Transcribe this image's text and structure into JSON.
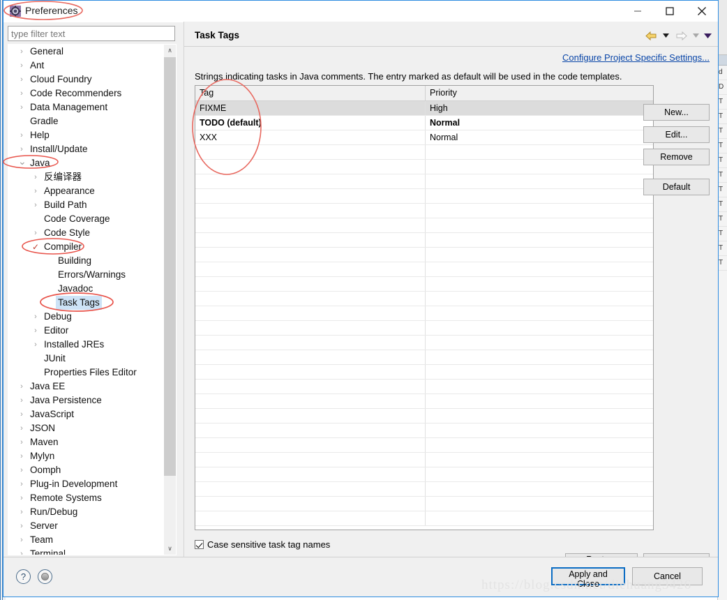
{
  "window": {
    "title": "Preferences",
    "icon": "preferences-gear-icon",
    "minimize_label": "Minimize",
    "maximize_label": "Maximize",
    "close_label": "Close"
  },
  "filter": {
    "placeholder": "type filter text",
    "value": ""
  },
  "tree": {
    "items": [
      {
        "label": "General",
        "indent": 0,
        "arrow": "collapsed",
        "check": false,
        "selected": false
      },
      {
        "label": "Ant",
        "indent": 0,
        "arrow": "collapsed",
        "check": false,
        "selected": false
      },
      {
        "label": "Cloud Foundry",
        "indent": 0,
        "arrow": "collapsed",
        "check": false,
        "selected": false
      },
      {
        "label": "Code Recommenders",
        "indent": 0,
        "arrow": "collapsed",
        "check": false,
        "selected": false
      },
      {
        "label": "Data Management",
        "indent": 0,
        "arrow": "collapsed",
        "check": false,
        "selected": false
      },
      {
        "label": "Gradle",
        "indent": 0,
        "arrow": "none",
        "check": false,
        "selected": false
      },
      {
        "label": "Help",
        "indent": 0,
        "arrow": "collapsed",
        "check": false,
        "selected": false
      },
      {
        "label": "Install/Update",
        "indent": 0,
        "arrow": "collapsed",
        "check": false,
        "selected": false
      },
      {
        "label": "Java",
        "indent": 0,
        "arrow": "expanded",
        "check": false,
        "selected": false
      },
      {
        "label": "反编译器",
        "indent": 1,
        "arrow": "collapsed",
        "check": false,
        "selected": false
      },
      {
        "label": "Appearance",
        "indent": 1,
        "arrow": "collapsed",
        "check": false,
        "selected": false
      },
      {
        "label": "Build Path",
        "indent": 1,
        "arrow": "collapsed",
        "check": false,
        "selected": false
      },
      {
        "label": "Code Coverage",
        "indent": 1,
        "arrow": "none",
        "check": false,
        "selected": false
      },
      {
        "label": "Code Style",
        "indent": 1,
        "arrow": "collapsed",
        "check": false,
        "selected": false
      },
      {
        "label": "Compiler",
        "indent": 1,
        "arrow": "check",
        "check": true,
        "selected": false
      },
      {
        "label": "Building",
        "indent": 2,
        "arrow": "none",
        "check": false,
        "selected": false
      },
      {
        "label": "Errors/Warnings",
        "indent": 2,
        "arrow": "none",
        "check": false,
        "selected": false
      },
      {
        "label": "Javadoc",
        "indent": 2,
        "arrow": "none",
        "check": false,
        "selected": false
      },
      {
        "label": "Task Tags",
        "indent": 2,
        "arrow": "none",
        "check": false,
        "selected": true
      },
      {
        "label": "Debug",
        "indent": 1,
        "arrow": "collapsed",
        "check": false,
        "selected": false
      },
      {
        "label": "Editor",
        "indent": 1,
        "arrow": "collapsed",
        "check": false,
        "selected": false
      },
      {
        "label": "Installed JREs",
        "indent": 1,
        "arrow": "collapsed",
        "check": false,
        "selected": false
      },
      {
        "label": "JUnit",
        "indent": 1,
        "arrow": "none",
        "check": false,
        "selected": false
      },
      {
        "label": "Properties Files Editor",
        "indent": 1,
        "arrow": "none",
        "check": false,
        "selected": false
      },
      {
        "label": "Java EE",
        "indent": 0,
        "arrow": "collapsed",
        "check": false,
        "selected": false
      },
      {
        "label": "Java Persistence",
        "indent": 0,
        "arrow": "collapsed",
        "check": false,
        "selected": false
      },
      {
        "label": "JavaScript",
        "indent": 0,
        "arrow": "collapsed",
        "check": false,
        "selected": false
      },
      {
        "label": "JSON",
        "indent": 0,
        "arrow": "collapsed",
        "check": false,
        "selected": false
      },
      {
        "label": "Maven",
        "indent": 0,
        "arrow": "collapsed",
        "check": false,
        "selected": false
      },
      {
        "label": "Mylyn",
        "indent": 0,
        "arrow": "collapsed",
        "check": false,
        "selected": false
      },
      {
        "label": "Oomph",
        "indent": 0,
        "arrow": "collapsed",
        "check": false,
        "selected": false
      },
      {
        "label": "Plug-in Development",
        "indent": 0,
        "arrow": "collapsed",
        "check": false,
        "selected": false
      },
      {
        "label": "Remote Systems",
        "indent": 0,
        "arrow": "collapsed",
        "check": false,
        "selected": false
      },
      {
        "label": "Run/Debug",
        "indent": 0,
        "arrow": "collapsed",
        "check": false,
        "selected": false
      },
      {
        "label": "Server",
        "indent": 0,
        "arrow": "collapsed",
        "check": false,
        "selected": false
      },
      {
        "label": "Team",
        "indent": 0,
        "arrow": "collapsed",
        "check": false,
        "selected": false
      },
      {
        "label": "Terminal",
        "indent": 0,
        "arrow": "collapsed",
        "check": false,
        "selected": false
      }
    ],
    "scroll_up_glyph": "∧",
    "scroll_down_glyph": "∨"
  },
  "page": {
    "title": "Task Tags",
    "project_link": "Configure Project Specific Settings...",
    "description": "Strings indicating tasks in Java comments. The entry marked as default will be used in the code templates.",
    "nav": {
      "back_icon": "back-arrow-icon",
      "back_menu_icon": "dropdown-caret-icon",
      "forward_icon": "forward-arrow-icon",
      "forward_menu_icon": "dropdown-caret-icon",
      "menu_icon": "dropdown-caret-icon"
    }
  },
  "table": {
    "columns": [
      "Tag",
      "Priority"
    ],
    "rows": [
      {
        "tag": "FIXME",
        "priority": "High",
        "selected": true,
        "bold": false
      },
      {
        "tag": "TODO (default)",
        "priority": "Normal",
        "selected": false,
        "bold": true
      },
      {
        "tag": "XXX",
        "priority": "Normal",
        "selected": false,
        "bold": false
      }
    ],
    "empty_row_count": 26
  },
  "side_buttons": {
    "new": "New...",
    "edit": "Edit...",
    "remove": "Remove",
    "default": "Default"
  },
  "options": {
    "case_sensitive_label": "Case sensitive task tag names",
    "case_sensitive_checked": true
  },
  "footer": {
    "restore_defaults": "Restore Defaults",
    "apply": "Apply",
    "apply_and_close": "Apply and Close",
    "cancel": "Cancel",
    "help_icon": "question-mark-icon",
    "shell_icon": "shell-circle-icon"
  },
  "watermark": "https://blog.csdn.net/diehuang3426",
  "colors": {
    "dialog_border": "#2d8ce0",
    "accent_button_border": "#0a6cc4",
    "link": "#0a46a8",
    "selection": "#cde3f7",
    "row_selection": "#dcdcdc",
    "annotation": "#e8534a",
    "panel_bg": "#f0f0f0"
  },
  "background_right": {
    "rows": [
      "d",
      "D",
      "T",
      "T",
      "T",
      "T",
      "T",
      "T",
      "T",
      "T",
      "T",
      "T",
      "T",
      "T"
    ]
  }
}
